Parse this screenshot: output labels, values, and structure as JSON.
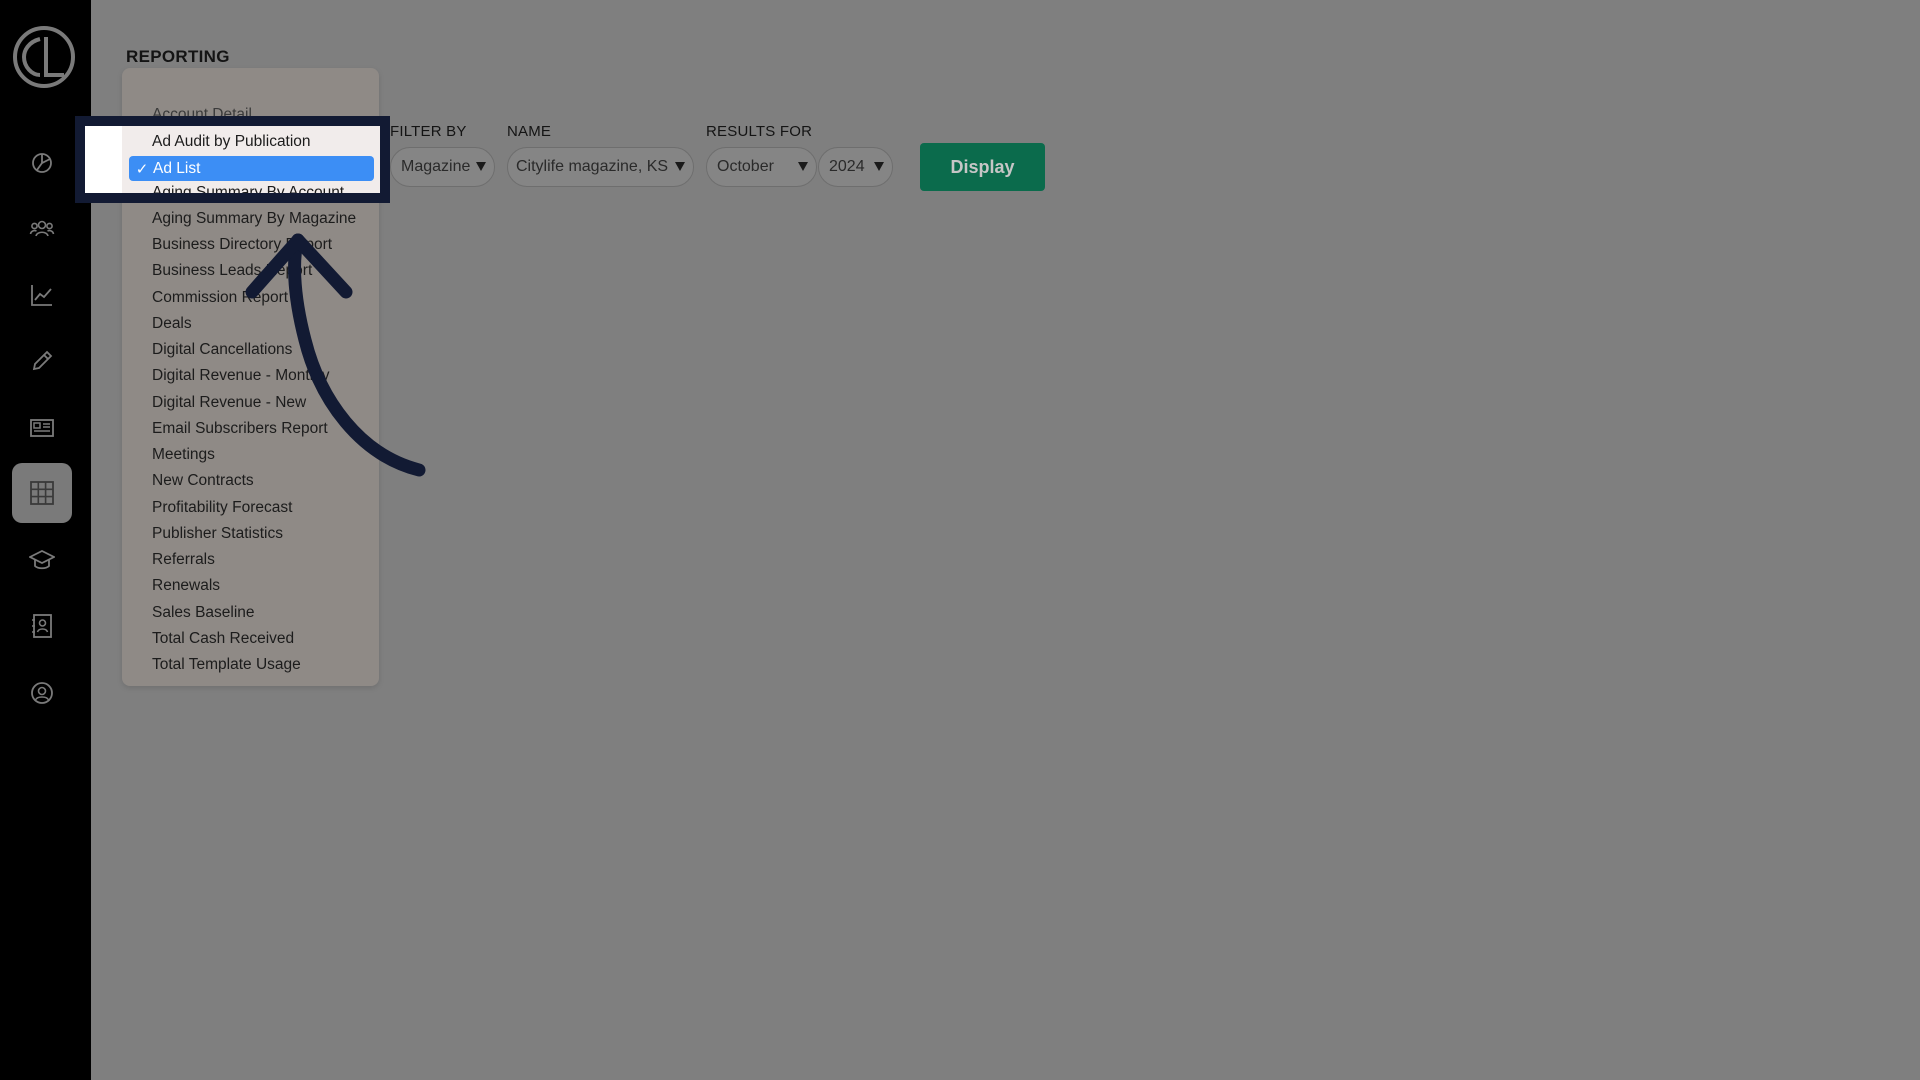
{
  "nav": {
    "items": [
      {
        "name": "dashboard-icon"
      },
      {
        "name": "users-icon"
      },
      {
        "name": "analytics-icon"
      },
      {
        "name": "edit-icon"
      },
      {
        "name": "publications-icon"
      },
      {
        "name": "reports-grid-icon",
        "active": true
      },
      {
        "name": "training-icon"
      },
      {
        "name": "contacts-icon"
      },
      {
        "name": "account-icon"
      }
    ]
  },
  "page": {
    "title": "REPORTING"
  },
  "filters": {
    "filter_by_label": "FILTER BY",
    "filter_by_value": "Magazine",
    "name_label": "NAME",
    "name_value": "Citylife magazine, KS",
    "results_for_label": "RESULTS FOR",
    "month_value": "October",
    "year_value": "2024",
    "display_button": "Display"
  },
  "report_dropdown": {
    "selected": "Ad List",
    "items": [
      "Account Detail",
      "Ad Audit by Publication",
      "Ad List",
      "Aging Summary By Account",
      "Aging Summary By Magazine",
      "Business Directory Report",
      "Business Leads Report",
      "Commission Report",
      "Deals",
      "Digital Cancellations",
      "Digital Revenue - Monthly",
      "Digital Revenue - New",
      "Email Subscribers Report",
      "Meetings",
      "New Contracts",
      "Profitability Forecast",
      "Publisher Statistics",
      "Referrals",
      "Renewals",
      "Sales Baseline",
      "Total Cash Received",
      "Total Template Usage"
    ]
  },
  "colors": {
    "overlay_dim": "#7f7f7f",
    "selected_item": "#3c8ef5",
    "display_button": "#0b6b4c",
    "annotation": "#121a33"
  }
}
